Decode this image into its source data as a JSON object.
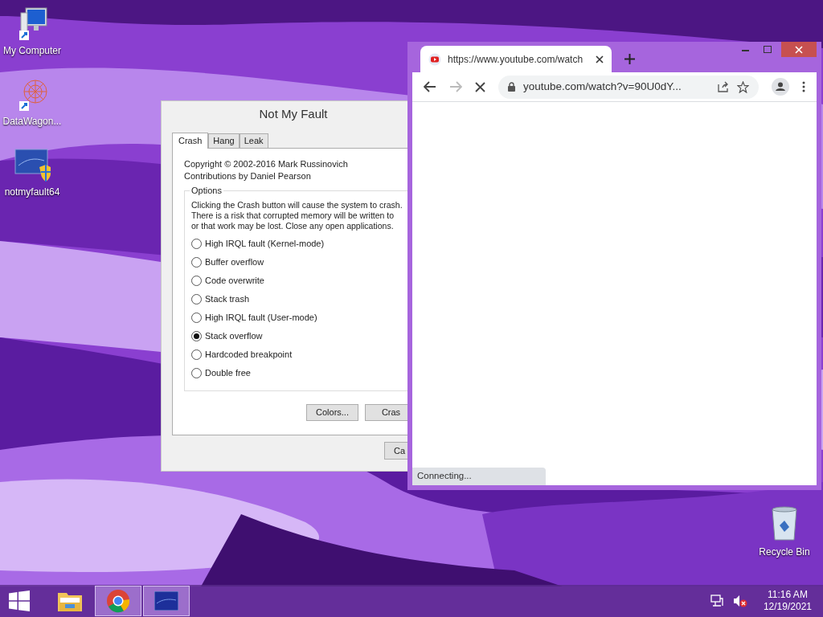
{
  "desktop_icons": [
    {
      "kind": "computer",
      "label": "My Computer"
    },
    {
      "kind": "datawagon",
      "label": "DataWagon..."
    },
    {
      "kind": "notmyfault",
      "label": "notmyfault64"
    }
  ],
  "recycle_bin": {
    "label": "Recycle Bin"
  },
  "dialog": {
    "title": "Not My Fault",
    "tabs": [
      {
        "label": "Crash",
        "selected": true
      },
      {
        "label": "Hang",
        "selected": false
      },
      {
        "label": "Leak",
        "selected": false
      }
    ],
    "credits": [
      "Copyright © 2002-2016 Mark Russinovich",
      "Contributions by Daniel Pearson"
    ],
    "options": {
      "legend": "Options",
      "description": [
        "Clicking the Crash button will cause the system to crash.",
        "There is a risk that corrupted memory will be written to",
        "or that work may be lost. Close any open applications."
      ],
      "radios": [
        {
          "label": "High IRQL fault (Kernel-mode)",
          "selected": false
        },
        {
          "label": "Buffer overflow",
          "selected": false
        },
        {
          "label": "Code overwrite",
          "selected": false
        },
        {
          "label": "Stack trash",
          "selected": false
        },
        {
          "label": "High IRQL fault (User-mode)",
          "selected": false
        },
        {
          "label": "Stack overflow",
          "selected": true
        },
        {
          "label": "Hardcoded breakpoint",
          "selected": false
        },
        {
          "label": "Double free",
          "selected": false
        }
      ]
    },
    "buttons": [
      "Colors...",
      "Cras"
    ],
    "footer_button": "Ca"
  },
  "browser": {
    "tab_title": "https://www.youtube.com/watch",
    "address": "youtube.com/watch?v=90U0dY...",
    "status": "Connecting..."
  },
  "taskbar": {
    "items": [
      {
        "kind": "explorer",
        "selected": false
      },
      {
        "kind": "chrome",
        "selected": true
      },
      {
        "kind": "notmyfault",
        "selected": true
      }
    ],
    "time": "11:16 AM",
    "date": "12/19/2021"
  }
}
